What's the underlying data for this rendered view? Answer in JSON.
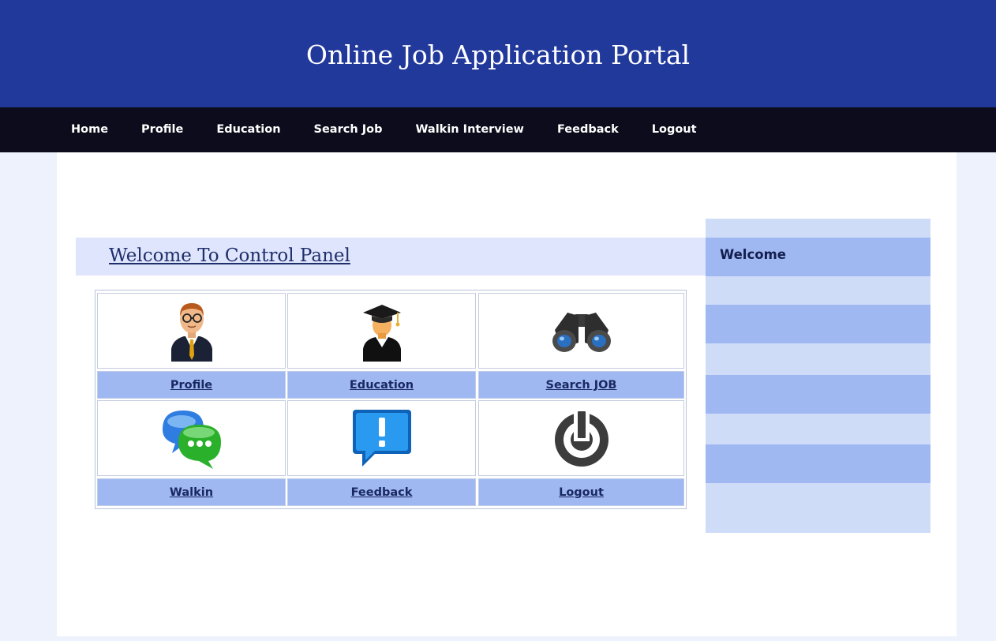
{
  "header": {
    "title": "Online Job Application Portal"
  },
  "nav": {
    "items": [
      {
        "label": "Home"
      },
      {
        "label": "Profile"
      },
      {
        "label": "Education"
      },
      {
        "label": "Search Job"
      },
      {
        "label": "Walkin Interview"
      },
      {
        "label": "Feedback"
      },
      {
        "label": "Logout"
      }
    ]
  },
  "main": {
    "heading": "Welcome To Control Panel",
    "panel": [
      {
        "label": "Profile",
        "icon": "user-icon"
      },
      {
        "label": "Education",
        "icon": "graduate-icon"
      },
      {
        "label": "Search JOB",
        "icon": "binoculars-icon"
      },
      {
        "label": "Walkin",
        "icon": "chat-icon"
      },
      {
        "label": "Feedback",
        "icon": "alert-message-icon"
      },
      {
        "label": "Logout",
        "icon": "power-icon"
      }
    ]
  },
  "sidebar": {
    "title": "Welcome"
  },
  "colors": {
    "header_bg": "#22399c",
    "nav_bg": "#0c0c1c",
    "link_cell_bg": "#9fb8f2",
    "sidebar_light": "#cfdcf8",
    "sidebar_dark": "#a0b8f2"
  }
}
